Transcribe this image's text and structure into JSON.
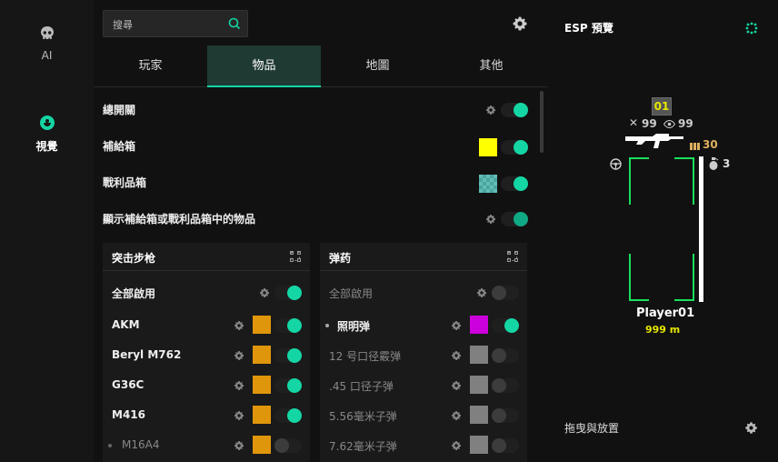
{
  "nav": {
    "items": [
      {
        "label": "AI",
        "icon": "skull-icon"
      },
      {
        "label": "視覺",
        "icon": "eye-icon"
      }
    ]
  },
  "search": {
    "placeholder": "搜尋"
  },
  "tabs": [
    "玩家",
    "物品",
    "地圖",
    "其他"
  ],
  "active_tab": "物品",
  "settings": [
    {
      "label": "總開關",
      "swatch": null,
      "toggle": true
    },
    {
      "label": "補給箱",
      "swatch": "#ffff00",
      "toggle": true
    },
    {
      "label": "戰利品箱",
      "swatch": "#4aa5a0",
      "toggle": true
    },
    {
      "label": "顯示補給箱或戰利品箱中的物品",
      "swatch": null,
      "toggle": true
    }
  ],
  "assault_card": {
    "title": "突击步枪",
    "enable_all": "全部啟用",
    "items": [
      {
        "name": "AKM",
        "color": "#e0960a",
        "on": true,
        "dim": false
      },
      {
        "name": "Beryl M762",
        "color": "#e0960a",
        "on": true,
        "dim": false
      },
      {
        "name": "G36C",
        "color": "#e0960a",
        "on": true,
        "dim": false
      },
      {
        "name": "M416",
        "color": "#e0960a",
        "on": true,
        "dim": false
      },
      {
        "name": "M16A4",
        "color": "#e0960a",
        "on": false,
        "dim": true
      }
    ]
  },
  "ammo_card": {
    "title": "弹药",
    "enable_all": "全部啟用",
    "items": [
      {
        "name": "照明弹",
        "color": "#cc00dd",
        "on": true,
        "dim": false
      },
      {
        "name": "12 号口径霰弹",
        "color": "#808080",
        "on": false,
        "dim": true
      },
      {
        "name": ".45 口径子弹",
        "color": "#808080",
        "on": false,
        "dim": true
      },
      {
        "name": "5.56毫米子弹",
        "color": "#808080",
        "on": false,
        "dim": true
      },
      {
        "name": "7.62毫米子弹",
        "color": "#808080",
        "on": false,
        "dim": true
      }
    ]
  },
  "preview": {
    "title": "ESP 預覽",
    "team_number": "01",
    "kills": "99",
    "spectators": "99",
    "ammo": "30",
    "grenades": "3",
    "player_name": "Player01",
    "distance": "999 m",
    "drag_label": "拖曳與放置"
  },
  "colors": {
    "accent": "#14d6a4",
    "box": "#19e05c",
    "distance": "#e6e600",
    "ammo": "#e0b060"
  }
}
